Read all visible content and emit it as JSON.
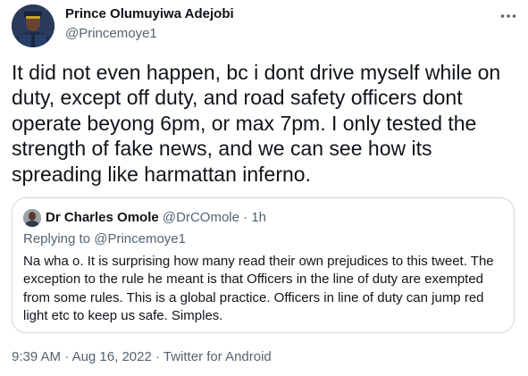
{
  "author": {
    "name": "Prince Olumuyiwa Adejobi",
    "handle": "@Princemoye1"
  },
  "tweet": {
    "text": "It did not even happen, bc i dont drive myself while on duty, except off duty, and road safety officers dont operate beyong 6pm, or max 7pm. I only tested the strength of fake news, and we can see how its spreading like harmattan inferno."
  },
  "quote": {
    "name": "Dr Charles Omole",
    "handle": "@DrCOmole",
    "separator": "·",
    "time": "1h",
    "replying_prefix": "Replying to ",
    "replying_handle": "@Princemoye1",
    "text": "Na wha o. It is surprising how many read their own prejudices to this tweet. The exception to the rule he meant is that Officers in the line of duty are exempted from some rules. This is a global practice. Officers in line of duty can jump red light etc to keep us safe. Simples."
  },
  "meta": {
    "time": "9:39 AM",
    "dot1": "·",
    "date": "Aug 16, 2022",
    "dot2": "·",
    "source": "Twitter for Android"
  },
  "colors": {
    "text_primary": "#0f1419",
    "text_secondary": "#536471",
    "border": "#cfd9de"
  },
  "icons": {
    "more": "more-horizontal-icon"
  }
}
